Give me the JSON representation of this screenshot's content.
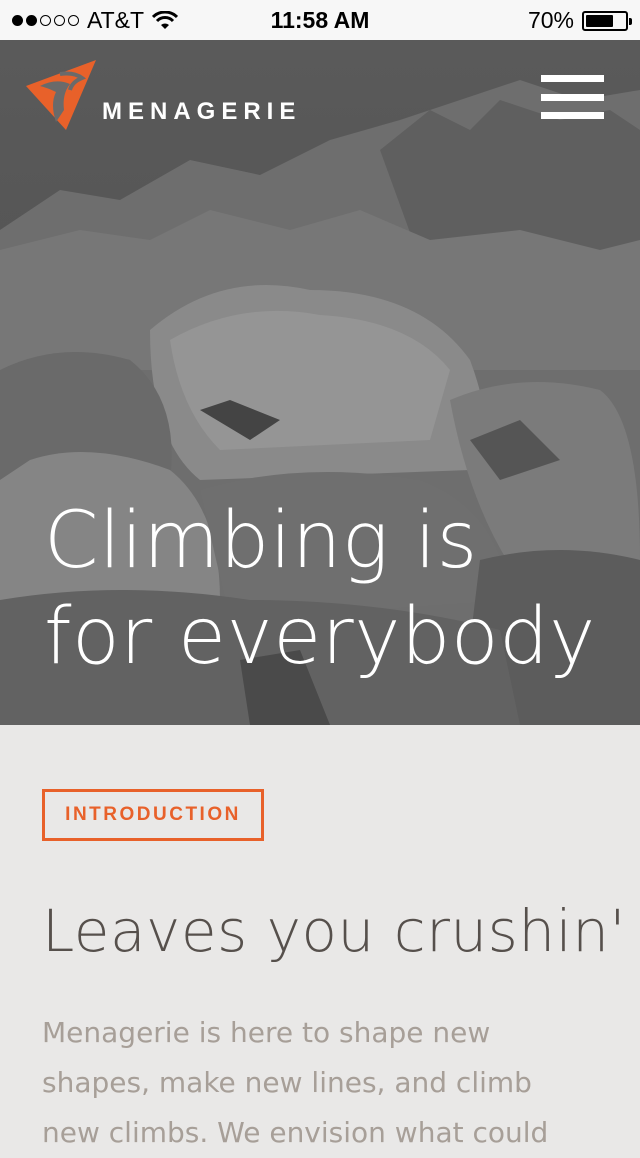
{
  "status_bar": {
    "carrier": "AT&T",
    "signal_bars": 2,
    "time": "11:58 AM",
    "battery": "70%",
    "battery_level": 0.7
  },
  "header": {
    "brand": "MENAGERIE",
    "logo_icon": "menagerie-logo-icon",
    "menu_icon": "hamburger-menu-icon",
    "brand_color": "#e8612a"
  },
  "hero": {
    "headline_line1": "Climbing is",
    "headline_line2": "for everybody"
  },
  "intro": {
    "badge": "INTRODUCTION",
    "title": "Leaves you crushin'",
    "body": "Menagerie is here to shape new shapes, make new lines, and climb new climbs. We envision what could"
  }
}
